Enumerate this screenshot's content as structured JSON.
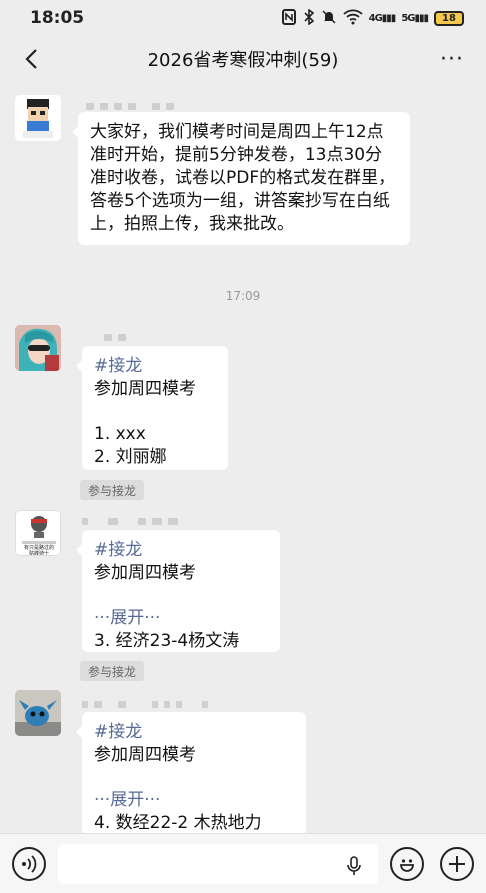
{
  "status_bar": {
    "time": "18:05",
    "network_4g": "4G",
    "network_5g": "5G",
    "battery": "18"
  },
  "header": {
    "title": "2026省考寒假冲刺(59)",
    "more": "···"
  },
  "messages": [
    {
      "text": "大家好，我们模考时间是周四上午12点准时开始，提前5分钟发卷，13点30分准时收卷，试卷以PDF的格式发在群里，答卷5个选项为一组，讲答案抄写在白纸上，拍照上传，我来批改。"
    },
    {
      "tag": "#接龙",
      "line1": "参加周四模考",
      "item1": "1. xxx",
      "item2": "2. 刘丽娜"
    },
    {
      "tag": "#接龙",
      "line1": "参加周四模考",
      "expand": "···展开···",
      "item": "3. 经济23-4杨文涛"
    },
    {
      "tag": "#接龙",
      "line1": "参加周四模考",
      "expand": "···展开···",
      "item": "4. 数经22-2 木热地力"
    }
  ],
  "time_separator": "17:09",
  "join_chip": "参与接龙",
  "avatar2_caption": "有只是路过的\n骷髅骑士",
  "avatar1_caption": "鸟头部网"
}
